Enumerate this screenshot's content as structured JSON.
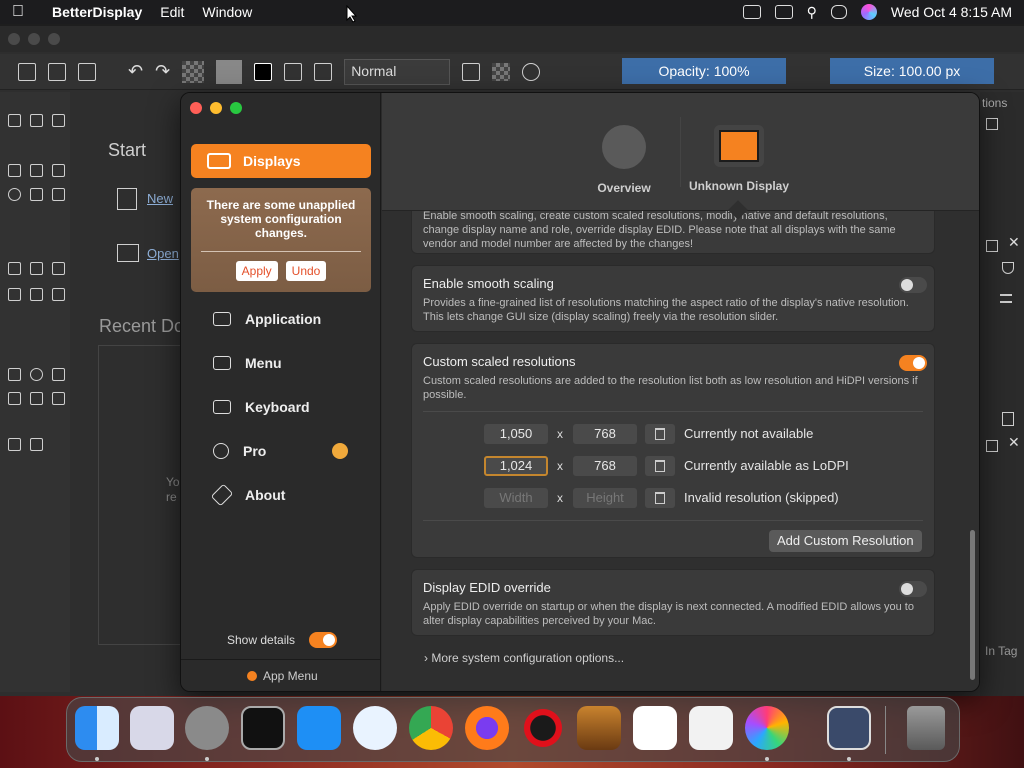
{
  "menubar": {
    "app_name": "BetterDisplay",
    "menus": [
      "Edit",
      "Window"
    ],
    "clock": "Wed Oct 4  8:15 AM"
  },
  "editor": {
    "blend_mode": "Normal",
    "opacity": "Opacity: 100%",
    "size": "Size: 100.00 px",
    "start": "Start",
    "new_link": "New",
    "open_link": "Open",
    "recent": "Recent Do",
    "ghost_text": [
      "Yo",
      "re"
    ],
    "right_panel_tab": "tions",
    "right_tag": "In Tag"
  },
  "sidebar": {
    "selected": "Displays",
    "notice": "There are some unapplied system configuration changes.",
    "apply": "Apply",
    "undo": "Undo",
    "items": [
      "Application",
      "Menu",
      "Keyboard",
      "Pro",
      "About"
    ],
    "show_details": "Show details",
    "app_menu": "App Menu"
  },
  "tabs": {
    "overview": "Overview",
    "display": "Unknown Display"
  },
  "top_card": {
    "desc": "Enable smooth scaling, create custom scaled resolutions, modify native and default resolutions, change display name and role, override display EDID. Please note that all displays with the same vendor and model number are affected by the changes!"
  },
  "smooth": {
    "title": "Enable smooth scaling",
    "desc": "Provides a fine-grained list of resolutions matching the aspect ratio of the display's native resolution. This lets change GUI size (display scaling) freely via the resolution slider."
  },
  "custom": {
    "title": "Custom scaled resolutions",
    "desc": "Custom scaled resolutions are added to the resolution list both as low resolution and HiDPI versions if possible.",
    "x": "x",
    "rows": [
      {
        "w": "1,050",
        "h": "768",
        "status": "Currently not available"
      },
      {
        "w": "1,024",
        "h": "768",
        "status": "Currently available as LoDPI"
      },
      {
        "w_placeholder": "Width",
        "h_placeholder": "Height",
        "status": "Invalid resolution (skipped)"
      }
    ],
    "add_button": "Add Custom Resolution"
  },
  "edid": {
    "title": "Display EDID override",
    "desc": "Apply EDID override on startup or when the display is next connected. A modified EDID allows you to alter display capabilities perceived by your Mac."
  },
  "more": "More system configuration options...",
  "colors": {
    "accent": "#f58220",
    "selection_blue": "#3d6ea8"
  },
  "dock": [
    "finder-icon",
    "launchpad-icon",
    "system-settings-icon",
    "terminal-icon",
    "app-store-icon",
    "safari-icon",
    "chrome-icon",
    "firefox-icon",
    "opera-icon",
    "garageband-icon",
    "vscode-icon",
    "textedit-icon",
    "pixelmator-icon",
    "betterdisplay-icon",
    "trash-icon"
  ]
}
